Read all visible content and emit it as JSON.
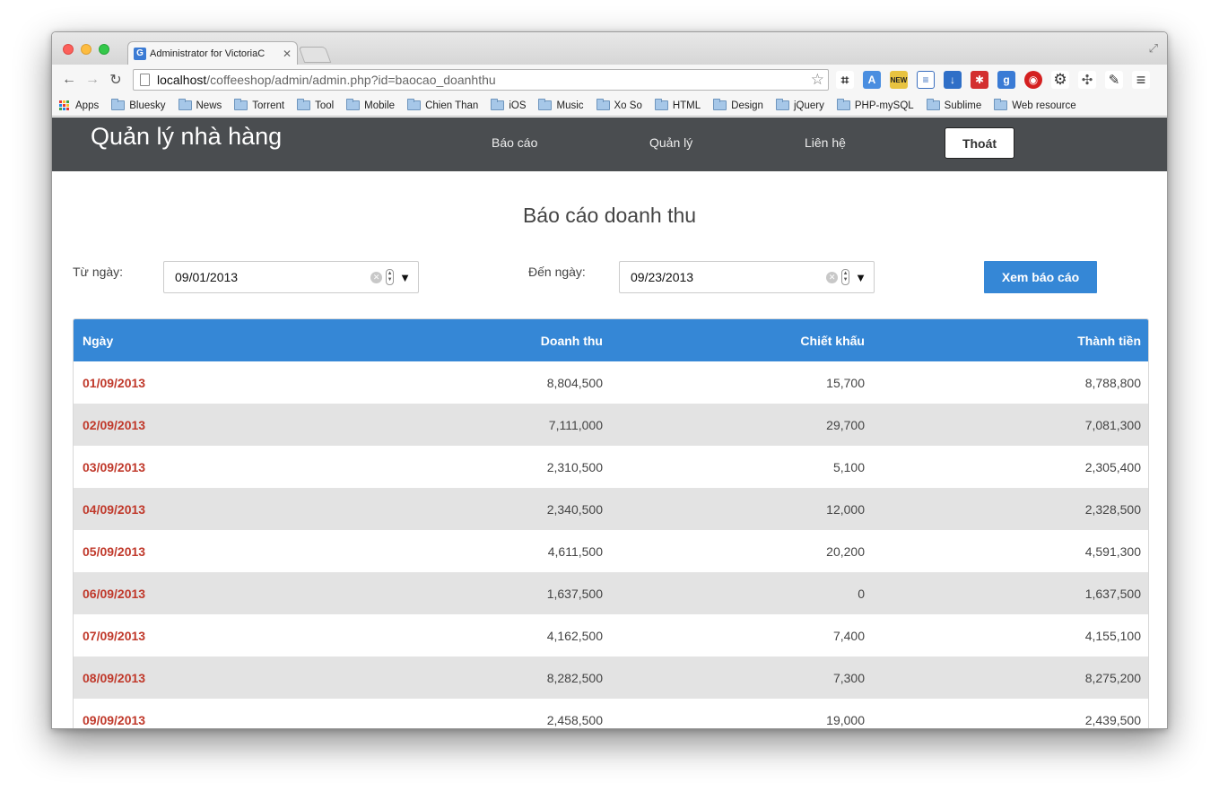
{
  "browser": {
    "tab_title": "Administrator for VictoriaC",
    "tab_favicon": "G",
    "url_host": "localhost",
    "url_path": "/coffeeshop/admin/admin.php?id=baocao_doanhthu",
    "bookmarks": [
      "Apps",
      "Bluesky",
      "News",
      "Torrent",
      "Tool",
      "Mobile",
      "Chien Than",
      "iOS",
      "Music",
      "Xo So",
      "HTML",
      "Design",
      "jQuery",
      "PHP-mySQL",
      "Sublime",
      "Web resource"
    ]
  },
  "header": {
    "brand": "Quản lý nhà hàng",
    "nav": [
      "Báo cáo",
      "Quản lý",
      "Liên hệ"
    ],
    "logout": "Thoát"
  },
  "report": {
    "title": "Báo cáo doanh thu",
    "from_label": "Từ ngày:",
    "from_value": "09/01/2013",
    "to_label": "Đến ngày:",
    "to_value": "09/23/2013",
    "view_button": "Xem báo cáo"
  },
  "table": {
    "headers": [
      "Ngày",
      "Doanh thu",
      "Chiết khấu",
      "Thành tiền"
    ],
    "rows": [
      [
        "01/09/2013",
        "8,804,500",
        "15,700",
        "8,788,800"
      ],
      [
        "02/09/2013",
        "7,111,000",
        "29,700",
        "7,081,300"
      ],
      [
        "03/09/2013",
        "2,310,500",
        "5,100",
        "2,305,400"
      ],
      [
        "04/09/2013",
        "2,340,500",
        "12,000",
        "2,328,500"
      ],
      [
        "05/09/2013",
        "4,611,500",
        "20,200",
        "4,591,300"
      ],
      [
        "06/09/2013",
        "1,637,500",
        "0",
        "1,637,500"
      ],
      [
        "07/09/2013",
        "4,162,500",
        "7,400",
        "4,155,100"
      ],
      [
        "08/09/2013",
        "8,282,500",
        "7,300",
        "8,275,200"
      ],
      [
        "09/09/2013",
        "2,458,500",
        "19,000",
        "2,439,500"
      ]
    ]
  },
  "colors": {
    "navbar": "#4a4d50",
    "accent_blue": "#3587d6",
    "date_red": "#c0392b",
    "row_alt": "#e3e3e3"
  }
}
